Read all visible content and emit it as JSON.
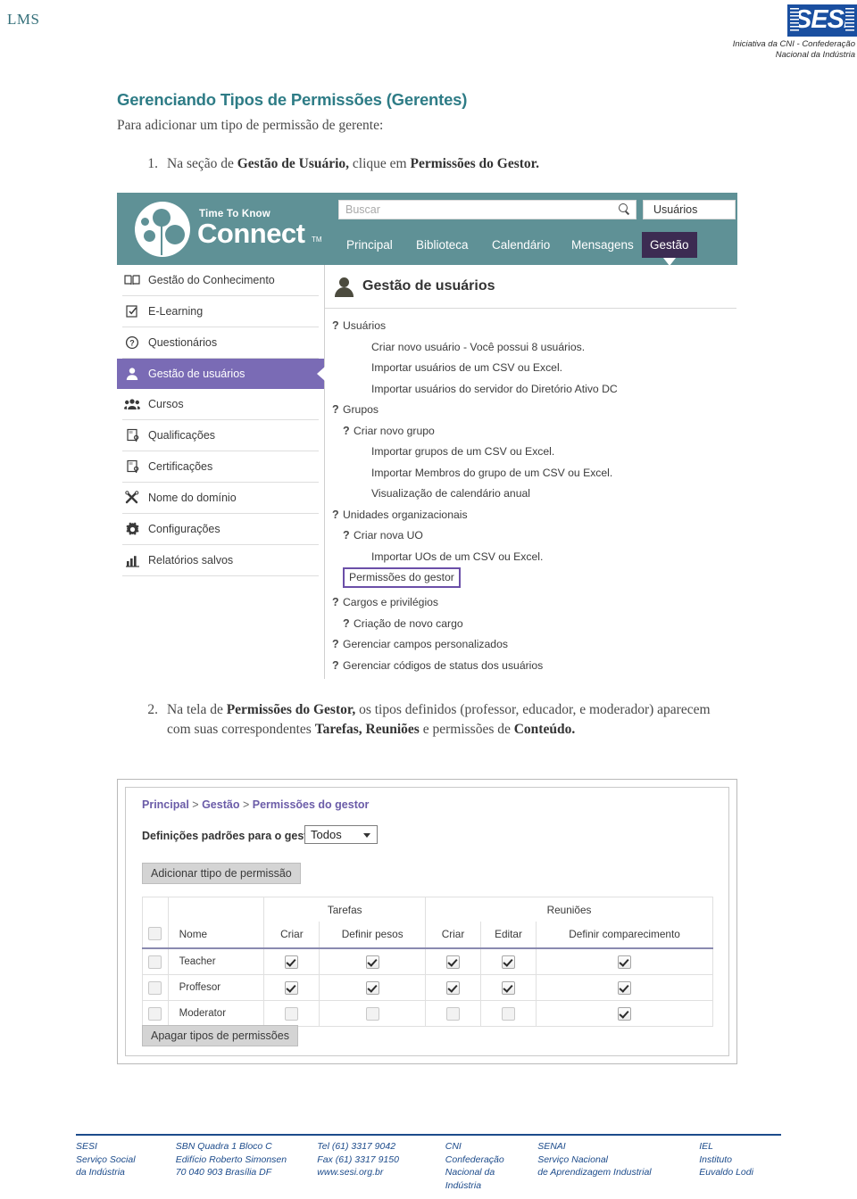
{
  "header": {
    "lms_label": "LMS",
    "logo_word": "SESI",
    "logo_tagline_line1": "Iniciativa da CNI - Confederação",
    "logo_tagline_line2": "Nacional da Indústria",
    "logo_color": "#1a4fa0"
  },
  "doc": {
    "title": "Gerenciando Tipos de Permissões (Gerentes)",
    "subtitle": "Para adicionar um tipo de permissão de gerente:",
    "title_color": "#2e7c86",
    "step1": {
      "number": "1.",
      "part1": "Na seção de ",
      "bold1": "Gestão de Usuário,",
      "part2": " clique em ",
      "bold2": "Permissões do Gestor."
    },
    "step2": {
      "number": "2.",
      "part1": "Na tela de ",
      "bold1": "Permissões do Gestor,",
      "part2": " os tipos definidos (professor, educador, e moderador) aparecem com suas correspondentes ",
      "bold2": "Tarefas, Reuniões",
      "part3": " e permissões de ",
      "bold3": "Conteúdo."
    }
  },
  "shot1": {
    "brand": {
      "eyebrow": "Time To Know",
      "name": "Connect",
      "tm": "TM",
      "bar_color": "#5f9196"
    },
    "search": {
      "placeholder": "Buscar"
    },
    "user_box": "Usuários",
    "nav": [
      {
        "label": "Principal",
        "active": false
      },
      {
        "label": "Biblioteca",
        "active": false
      },
      {
        "label": "Calendário",
        "active": false
      },
      {
        "label": "Mensagens",
        "active": false
      },
      {
        "label": "Gestão",
        "active": true
      }
    ],
    "nav_active_color": "#3c2b52",
    "sidebar": [
      {
        "label": "Gestão do Conhecimento",
        "icon": "book-icon",
        "selected": false
      },
      {
        "label": "E-Learning",
        "icon": "clipboard-check-icon",
        "selected": false
      },
      {
        "label": "Questionários",
        "icon": "question-circle-icon",
        "selected": false
      },
      {
        "label": "Gestão de usuários",
        "icon": "user-icon",
        "selected": true
      },
      {
        "label": "Cursos",
        "icon": "group-icon",
        "selected": false
      },
      {
        "label": "Qualificações",
        "icon": "badge-icon",
        "selected": false
      },
      {
        "label": "Certificações",
        "icon": "badge-icon",
        "selected": false
      },
      {
        "label": "Nome do domínio",
        "icon": "tools-icon",
        "selected": false
      },
      {
        "label": "Configurações",
        "icon": "gear-icon",
        "selected": false
      },
      {
        "label": "Relatórios salvos",
        "icon": "bar-chart-icon",
        "selected": false
      }
    ],
    "sidebar_selected_color": "#7a6bb5",
    "main_title": "Gestão de usuários",
    "links": [
      {
        "label": "Usuários",
        "level": 0,
        "marker": true,
        "boxed": false
      },
      {
        "label": "Criar novo usuário - Você possui 8 usuários.",
        "level": 2,
        "marker": false,
        "boxed": false
      },
      {
        "label": "Importar usuários de um CSV ou Excel.",
        "level": 2,
        "marker": false,
        "boxed": false
      },
      {
        "label": "Importar usuários do servidor do Diretório Ativo DC",
        "level": 2,
        "marker": false,
        "boxed": false
      },
      {
        "label": "Grupos",
        "level": 0,
        "marker": true,
        "boxed": false
      },
      {
        "label": "Criar novo grupo",
        "level": 1,
        "marker": true,
        "boxed": false
      },
      {
        "label": "Importar grupos de um CSV ou Excel.",
        "level": 2,
        "marker": false,
        "boxed": false
      },
      {
        "label": "Importar Membros do grupo de um CSV ou Excel.",
        "level": 2,
        "marker": false,
        "boxed": false
      },
      {
        "label": "Visualização de calendário anual",
        "level": 2,
        "marker": false,
        "boxed": false
      },
      {
        "label": "Unidades organizacionais",
        "level": 0,
        "marker": true,
        "boxed": false
      },
      {
        "label": "Criar nova UO",
        "level": 1,
        "marker": true,
        "boxed": false
      },
      {
        "label": "Importar UOs de um CSV ou Excel.",
        "level": 2,
        "marker": false,
        "boxed": false
      },
      {
        "label": "Permissões do gestor",
        "level": 0,
        "marker": false,
        "boxed": true
      },
      {
        "label": "Cargos e privilégios",
        "level": 0,
        "marker": true,
        "boxed": false
      },
      {
        "label": "Criação de novo cargo",
        "level": 1,
        "marker": true,
        "boxed": false
      },
      {
        "label": "Gerenciar campos personalizados",
        "level": 0,
        "marker": true,
        "boxed": false
      },
      {
        "label": "Gerenciar códigos de status dos usuários",
        "level": 0,
        "marker": true,
        "boxed": false
      }
    ],
    "highlight_box_color": "#6b4fa8"
  },
  "shot2": {
    "breadcrumb": {
      "item1": "Principal",
      "item2": "Gestão",
      "item3": "Permissões do gestor",
      "separator": ">"
    },
    "default_label": "Definições padrões para o gestor:",
    "default_select_value": "Todos",
    "add_button": "Adicionar ttipo de permissão",
    "delete_button": "Apagar tipos de permissões",
    "table": {
      "group_headers": [
        "",
        "",
        "Tarefas",
        "Reuniões"
      ],
      "columns": [
        "",
        "Nome",
        "Criar",
        "Definir pesos",
        "Criar",
        "Editar",
        "Definir comparecimento"
      ],
      "rows": [
        {
          "select": false,
          "name": "Teacher",
          "tarefas_criar": true,
          "tarefas_pesos": true,
          "reunioes_criar": true,
          "reunioes_editar": true,
          "reunioes_comparecimento": true
        },
        {
          "select": false,
          "name": "Proffesor",
          "tarefas_criar": true,
          "tarefas_pesos": true,
          "reunioes_criar": true,
          "reunioes_editar": true,
          "reunioes_comparecimento": true
        },
        {
          "select": false,
          "name": "Moderator",
          "tarefas_criar": false,
          "tarefas_pesos": false,
          "reunioes_criar": false,
          "reunioes_editar": false,
          "reunioes_comparecimento": true
        }
      ]
    }
  },
  "footer": {
    "accent_color": "#1c4b8b",
    "columns": [
      [
        "SESI",
        "Serviço Social",
        "da Indústria"
      ],
      [
        "SBN Quadra 1 Bloco C",
        "Edifício Roberto Simonsen",
        "70 040 903 Brasília DF"
      ],
      [
        "Tel (61) 3317 9042",
        "Fax (61) 3317 9150",
        "www.sesi.org.br"
      ],
      [
        "CNI",
        "Confederação",
        "Nacional da",
        "Indústria"
      ],
      [
        "SENAI",
        "Serviço Nacional",
        "de Aprendizagem Industrial"
      ],
      [
        "IEL",
        "Instituto",
        "Euvaldo Lodi"
      ]
    ]
  }
}
